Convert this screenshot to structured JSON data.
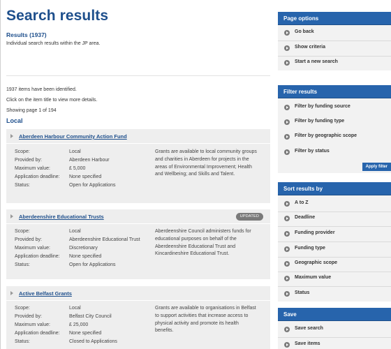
{
  "page": {
    "title": "Search results",
    "results_count": "Results (1937)",
    "description": "Individual search results within the JP area."
  },
  "listing": {
    "identified": "1937 items have been identified.",
    "instruction": "Click on the item title to view more details.",
    "showing": "Showing page 1 of 194",
    "section": "Local",
    "field_labels": {
      "scope": "Scope:",
      "provided_by": "Provided by:",
      "max_value": "Maximum value:",
      "deadline": "Application deadline:",
      "status": "Status:"
    },
    "items": [
      {
        "title": "Aberdeen Harbour Community Action Fund",
        "badge": "",
        "scope": "Local",
        "provided_by": "Aberdeen Harbour",
        "max_value": "£ 5,000",
        "deadline": "None specified",
        "status": "Open for Applications",
        "desc_lines": [
          "Grants are available to local community groups",
          "and charities in Aberdeen for projects in the",
          "areas of Environmental Improvement; Health",
          "and Wellbeing; and Skills and Talent."
        ]
      },
      {
        "title": "Aberdeenshire Educational Trusts",
        "badge": "UPDATED",
        "scope": "Local",
        "provided_by": "Aberdeenshire Educational Trust",
        "max_value": "Discretionary",
        "deadline": "None specified",
        "status": "Open for Applications",
        "desc_lines": [
          "Aberdeenshire Council administers funds for",
          "educational purposes on behalf of the",
          "Aberdeenshire Educational Trust and",
          "Kincardineshire Educational Trust."
        ]
      },
      {
        "title": "Active Belfast Grants",
        "badge": "",
        "scope": "Local",
        "provided_by": "Belfast City Council",
        "max_value": "£ 25,000",
        "deadline": "None specified",
        "status": "Closed to Applications",
        "desc_lines": [
          "Grants are available to organisations in Belfast",
          "to support activities that increase access to",
          "physical activity and promote its health",
          "benefits."
        ]
      }
    ]
  },
  "sidebar": {
    "page_options": {
      "heading": "Page options",
      "items": [
        "Go back",
        "Show criteria",
        "Start a new search"
      ]
    },
    "filter": {
      "heading": "Filter results",
      "items": [
        "Filter by funding source",
        "Filter by funding type",
        "Filter by geographic scope",
        "Filter by status"
      ],
      "apply_label": "Apply filter"
    },
    "sort": {
      "heading": "Sort results by",
      "items": [
        "A to Z",
        "Deadline",
        "Funding provider",
        "Funding type",
        "Geographic scope",
        "Maximum value",
        "Status"
      ]
    },
    "save": {
      "heading": "Save",
      "items": [
        "Save search",
        "Save items"
      ]
    }
  },
  "colors": {
    "brand_blue": "#1e4f8c",
    "sidebar_header": "#2764ac",
    "card_background": "#eeeeee",
    "badge_background": "#7a7a7a"
  },
  "icons": {
    "sidebar_bullet": "circle-arrow-icon",
    "card_toggle": "triangle-right-icon"
  }
}
